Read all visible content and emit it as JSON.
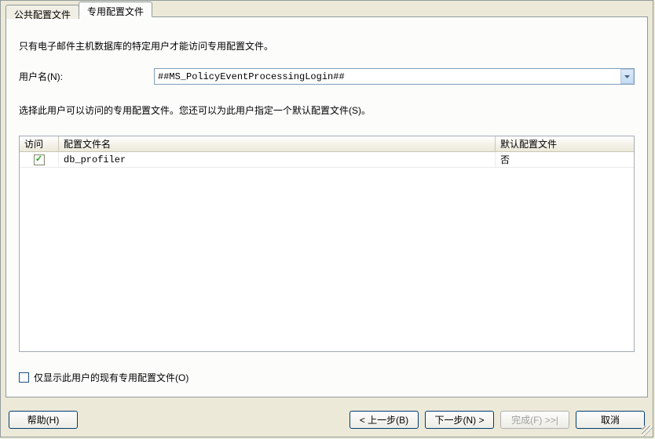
{
  "tabs": [
    {
      "label": "公共配置文件",
      "active": false
    },
    {
      "label": "专用配置文件",
      "active": true
    }
  ],
  "description1": "只有电子邮件主机数据库的特定用户才能访问专用配置文件。",
  "username_label": "用户名(N):",
  "username_value": "##MS_PolicyEventProcessingLogin##",
  "description2": "选择此用户可以访问的专用配置文件。您还可以为此用户指定一个默认配置文件(S)。",
  "table": {
    "headers": {
      "access": "访问",
      "profile_name": "配置文件名",
      "default_profile": "默认配置文件"
    },
    "rows": [
      {
        "checked": true,
        "name": "db_profiler",
        "is_default": "否"
      }
    ]
  },
  "show_only_checkbox_label": "仅显示此用户的现有专用配置文件(O)",
  "buttons": {
    "help": "帮助(H)",
    "back": "< 上一步(B)",
    "next": "下一步(N) >",
    "finish": "完成(F) >>|",
    "cancel": "取消"
  }
}
